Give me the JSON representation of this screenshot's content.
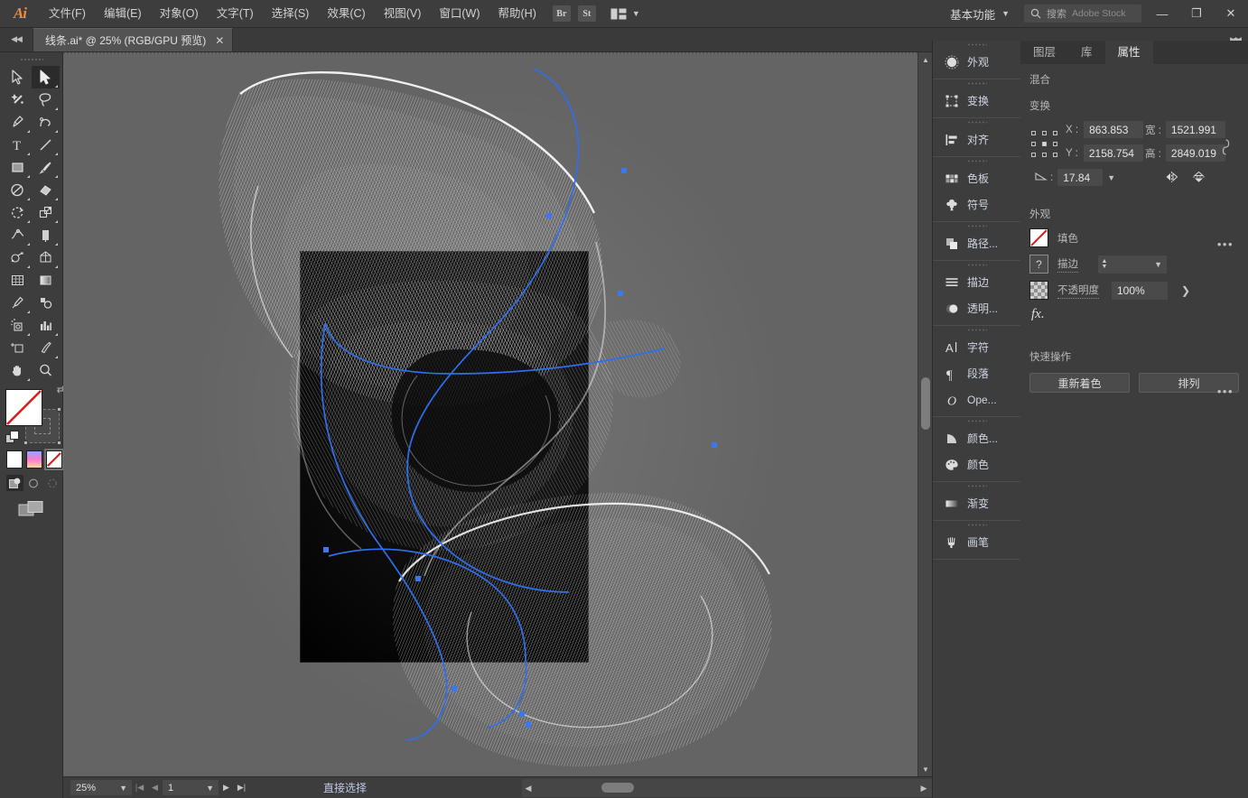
{
  "app": {
    "logo": "Ai",
    "menus": [
      "文件(F)",
      "编辑(E)",
      "对象(O)",
      "文字(T)",
      "选择(S)",
      "效果(C)",
      "视图(V)",
      "窗口(W)",
      "帮助(H)"
    ],
    "bridge_button": "Br",
    "stock_button": "St",
    "workspace": "基本功能",
    "search_label": "搜索",
    "search_placeholder": "Adobe Stock",
    "window_minimize": "—",
    "window_maximize": "❐",
    "window_close": "✕"
  },
  "document_tab": {
    "title": "线条.ai* @ 25% (RGB/GPU 预览)",
    "close": "✕"
  },
  "toolbar": {
    "tools": [
      {
        "name": "selection-tool",
        "label": "选择工具",
        "selected": false
      },
      {
        "name": "direct-selection-tool",
        "label": "直接选择工具",
        "selected": true
      },
      {
        "name": "magic-wand-tool",
        "label": "魔棒工具",
        "selected": false
      },
      {
        "name": "lasso-tool",
        "label": "套索工具",
        "selected": false
      },
      {
        "name": "pen-tool",
        "label": "钢笔工具",
        "selected": false
      },
      {
        "name": "curvature-tool",
        "label": "曲率工具",
        "selected": false
      },
      {
        "name": "type-tool",
        "label": "文字工具",
        "selected": false
      },
      {
        "name": "line-segment-tool",
        "label": "直线段工具",
        "selected": false
      },
      {
        "name": "rectangle-tool",
        "label": "矩形工具",
        "selected": false
      },
      {
        "name": "paintbrush-tool",
        "label": "画笔工具",
        "selected": false
      },
      {
        "name": "shaper-tool",
        "label": "Shaper 工具",
        "selected": false
      },
      {
        "name": "eraser-tool",
        "label": "橡皮擦工具",
        "selected": false
      },
      {
        "name": "rotate-tool",
        "label": "旋转工具",
        "selected": false
      },
      {
        "name": "scale-tool",
        "label": "比例缩放工具",
        "selected": false
      },
      {
        "name": "width-tool",
        "label": "宽度工具",
        "selected": false
      },
      {
        "name": "free-transform-tool",
        "label": "自由变换工具",
        "selected": false
      },
      {
        "name": "shape-builder-tool",
        "label": "形状生成器工具",
        "selected": false
      },
      {
        "name": "perspective-grid-tool",
        "label": "透视网格工具",
        "selected": false
      },
      {
        "name": "mesh-tool",
        "label": "网格工具",
        "selected": false
      },
      {
        "name": "gradient-tool",
        "label": "渐变工具",
        "selected": false
      },
      {
        "name": "eyedropper-tool",
        "label": "吸管工具",
        "selected": false
      },
      {
        "name": "blend-tool",
        "label": "混合工具",
        "selected": false
      },
      {
        "name": "symbol-sprayer-tool",
        "label": "符号喷枪工具",
        "selected": false
      },
      {
        "name": "column-graph-tool",
        "label": "柱形图工具",
        "selected": false
      },
      {
        "name": "artboard-tool",
        "label": "画板工具",
        "selected": false
      },
      {
        "name": "slice-tool",
        "label": "切片工具",
        "selected": false
      },
      {
        "name": "hand-tool",
        "label": "抓手工具",
        "selected": false
      },
      {
        "name": "zoom-tool",
        "label": "缩放工具",
        "selected": false
      }
    ],
    "fill_color": "#ffffff",
    "fill_none": true,
    "stroke_none": true,
    "color_modes": [
      {
        "name": "color-mode-flat",
        "color": "#ffffff",
        "selected": false
      },
      {
        "name": "color-mode-gradient",
        "color": "gradient",
        "selected": false
      },
      {
        "name": "color-mode-none",
        "color": "none",
        "selected": true
      }
    ],
    "draw_modes": [
      {
        "name": "draw-normal",
        "selected": true
      },
      {
        "name": "draw-behind",
        "selected": false
      },
      {
        "name": "draw-inside",
        "selected": false
      }
    ]
  },
  "canvas": {
    "background": "#646464",
    "artboard_fill": "#000000",
    "path_color": "#2f6fed",
    "anchor_color": "#3b78f0"
  },
  "statusbar": {
    "zoom": "25%",
    "page": "1",
    "tool_status": "直接选择"
  },
  "dock": {
    "groups": [
      {
        "items": [
          {
            "name": "appearance",
            "label": "外观",
            "icon": "appearance-icon"
          }
        ]
      },
      {
        "items": [
          {
            "name": "transform",
            "label": "变换",
            "icon": "transform-icon"
          }
        ]
      },
      {
        "items": [
          {
            "name": "align",
            "label": "对齐",
            "icon": "align-icon"
          }
        ]
      },
      {
        "items": [
          {
            "name": "swatches",
            "label": "色板",
            "icon": "swatches-icon"
          },
          {
            "name": "symbols",
            "label": "符号",
            "icon": "symbols-icon"
          }
        ]
      },
      {
        "items": [
          {
            "name": "pathfinder",
            "label": "路径...",
            "icon": "pathfinder-icon"
          }
        ]
      },
      {
        "items": [
          {
            "name": "stroke",
            "label": "描边",
            "icon": "stroke-icon"
          },
          {
            "name": "transparency",
            "label": "透明...",
            "icon": "transparency-icon"
          }
        ]
      },
      {
        "items": [
          {
            "name": "character",
            "label": "字符",
            "icon": "character-icon"
          },
          {
            "name": "paragraph",
            "label": "段落",
            "icon": "paragraph-icon"
          },
          {
            "name": "opentype",
            "label": "Ope...",
            "icon": "opentype-icon"
          }
        ]
      },
      {
        "items": [
          {
            "name": "color-guide",
            "label": "颜色...",
            "icon": "color-guide-icon"
          },
          {
            "name": "color",
            "label": "颜色",
            "icon": "color-icon"
          }
        ]
      },
      {
        "items": [
          {
            "name": "gradient",
            "label": "渐变",
            "icon": "gradient-icon"
          }
        ]
      },
      {
        "items": [
          {
            "name": "brushes",
            "label": "画笔",
            "icon": "brushes-icon"
          }
        ]
      }
    ]
  },
  "properties": {
    "tabs": [
      {
        "name": "layers",
        "label": "图层",
        "active": false
      },
      {
        "name": "libraries",
        "label": "库",
        "active": false
      },
      {
        "name": "properties",
        "label": "属性",
        "active": true
      }
    ],
    "blend_section": "混合",
    "transform": {
      "title": "变换",
      "x_label": "X :",
      "x_value": "863.853",
      "y_label": "Y :",
      "y_value": "2158.754",
      "w_label": "宽 :",
      "w_value": "1521.991",
      "h_label": "高 :",
      "h_value": "2849.019",
      "angle_value": "17.84",
      "more_options": "•••"
    },
    "appearance": {
      "title": "外观",
      "fill_label": "填色",
      "stroke_label": "描边",
      "stroke_weight": "",
      "opacity_label": "不透明度",
      "opacity_value": "100%",
      "fx_label": "fx.",
      "more_options": "•••"
    },
    "quick_actions": {
      "title": "快速操作",
      "recolor": "重新着色",
      "arrange": "排列"
    }
  }
}
